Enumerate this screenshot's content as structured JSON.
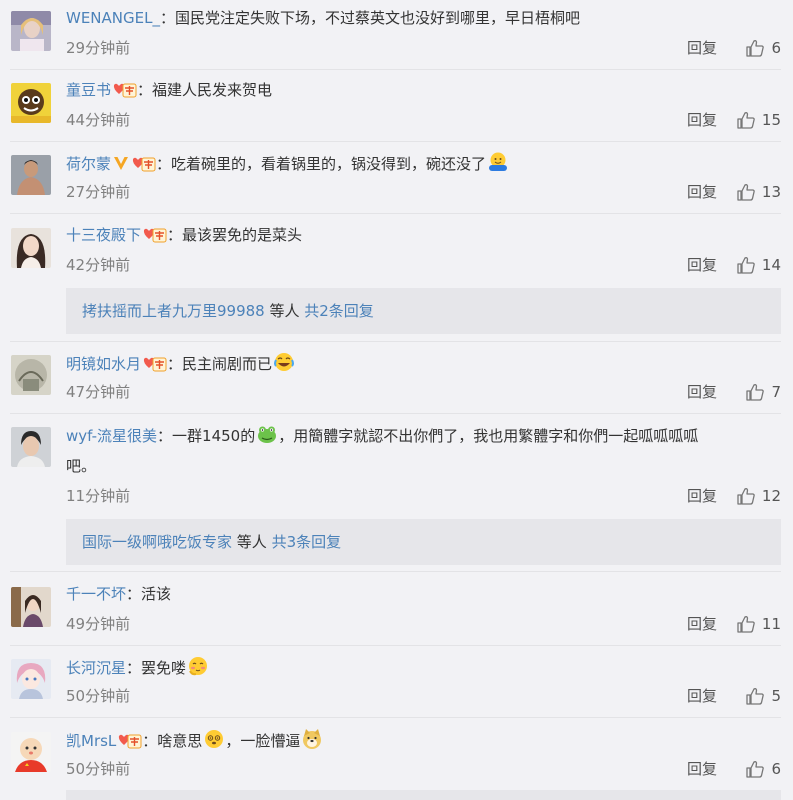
{
  "comments": [
    {
      "user": "WENANGEL_",
      "colon": "：",
      "text": "国民党注定失败下场，不过蔡英文也没好到哪里，早日梧桐吧",
      "time": "29分钟前",
      "reply": "回复",
      "likes": "6"
    },
    {
      "user": "童豆书",
      "colon": "：",
      "text": "福建人民发来贺电",
      "time": "44分钟前",
      "reply": "回复",
      "likes": "15"
    },
    {
      "user": "荷尔蒙",
      "colon": "：",
      "text": "吃着碗里的，看着锅里的，锅没得到，碗还没了",
      "time": "27分钟前",
      "reply": "回复",
      "likes": "13",
      "emoji": "hug-emoji"
    },
    {
      "user": "十三夜殿下",
      "colon": "：",
      "text": "最该罢免的是菜头",
      "time": "42分钟前",
      "reply": "回复",
      "likes": "14"
    },
    {
      "user": "明镜如水月",
      "colon": "：",
      "text": "民主闹剧而已",
      "time": "47分钟前",
      "reply": "回复",
      "likes": "7",
      "emoji": "laugh-cry-emoji"
    },
    {
      "user": "wyf-流星很美",
      "colon": "：",
      "text_a": "一群1450的",
      "text_b": "，用簡體字就認不出你們了，我也用繁體字和你們一起呱呱呱呱",
      "text_c": "吧。",
      "time": "11分钟前",
      "reply": "回复",
      "likes": "12",
      "emoji": "frog-emoji"
    },
    {
      "user": "千一不坏",
      "colon": "：",
      "text": "活该",
      "time": "49分钟前",
      "reply": "回复",
      "likes": "11"
    },
    {
      "user": "长河沉星",
      "colon": "：",
      "text": "罢免喽",
      "time": "50分钟前",
      "reply": "回复",
      "likes": "5",
      "emoji": "shy-emoji"
    },
    {
      "user": "凯MrsL",
      "colon": "：",
      "text_a": "啥意思",
      "text_b": "，一脸懵逼",
      "time": "50分钟前",
      "reply": "回复",
      "likes": "6",
      "emoji": "dizzy-emoji",
      "emoji2": "doge-emoji"
    }
  ],
  "subreplies": [
    {
      "user": "拷扶摇而上者九万里99988",
      "mid": " 等人 ",
      "count": "共2条回复"
    },
    {
      "user": "国际一级啊哦吃饭专家",
      "mid": " 等人 ",
      "count": "共3条回复"
    }
  ],
  "colors": {
    "link": "#4c82b9",
    "text": "#333333",
    "meta": "#808080",
    "background": "#f2f2f5"
  }
}
